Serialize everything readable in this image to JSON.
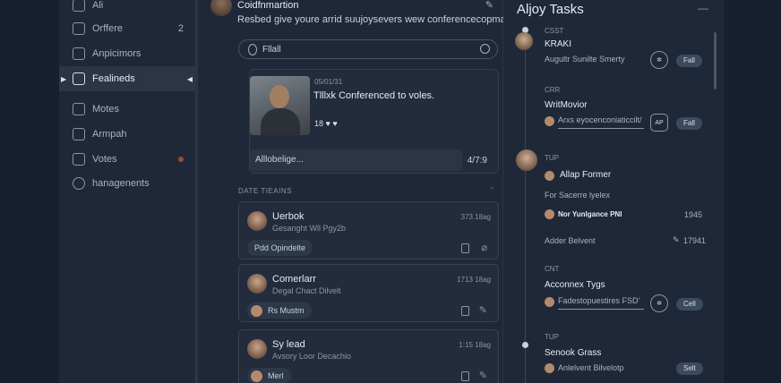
{
  "sidebar": {
    "items": [
      {
        "label": "Ali",
        "count": ""
      },
      {
        "label": "Orffere",
        "count": "2"
      },
      {
        "label": "Anpicimors",
        "count": ""
      },
      {
        "label": "Fealineds",
        "count": ""
      },
      {
        "label": "Motes",
        "count": ""
      },
      {
        "label": "Armpah",
        "count": ""
      },
      {
        "label": "Votes",
        "count": ""
      },
      {
        "label": "hanagenents",
        "count": ""
      }
    ]
  },
  "chat": {
    "title": "Coidfnmartion",
    "subtitle": "Resbed give youre arrid suujoysevers wew conferencecopmalie …",
    "search_placeholder": "Fllall",
    "featured": {
      "timestamp": "05/01/31",
      "title": "Tlllxk Conferenced to voles.",
      "reactions": "18 ♥ ♥",
      "input_placeholder": "Alllobelige...",
      "time": "4/7:9"
    },
    "section_header": "DATE TIEAINS",
    "cards": [
      {
        "name": "Uerbok",
        "sub": "Gesanght Wll Pgy2b",
        "time": "373.18ag",
        "pill": "Pdd Opindelte"
      },
      {
        "name": "Comerlarr",
        "sub": "Degal Chact Dilvelt",
        "time": "1713 18ag",
        "pill": "Rs Mustm"
      },
      {
        "name": "Sy lead",
        "sub": "Avsory Loor Decachio",
        "time": "1:15 18ag",
        "pill": "Merl"
      }
    ]
  },
  "tasks": {
    "title": "Aljoy Tasks",
    "groups": [
      {
        "tag": "CSST",
        "name": "KRAKI",
        "sub": "Augultr Sunilte Smerty",
        "badge": "Fall"
      },
      {
        "tag": "CRR",
        "name": "WritMovior",
        "sub": "Arxs eyocenconiaticcilt/",
        "badge": "Fall"
      },
      {
        "tag": "TUP",
        "name": "Allap Former",
        "sub": "For Sacerre lyelex",
        "sub2": "Nor Yunlgance PNI",
        "num": "1945",
        "footer": "Adder Belvent",
        "footer_num": "17941"
      },
      {
        "tag": "CNT",
        "name": "Acconnex Tygs",
        "sub": "Fadestopuestires FSD'",
        "badge": "Cell"
      },
      {
        "tag": "TUP",
        "name": "Senook Grass",
        "sub": "Anlelvent Bilvelotp",
        "badge": "Selt"
      }
    ]
  }
}
